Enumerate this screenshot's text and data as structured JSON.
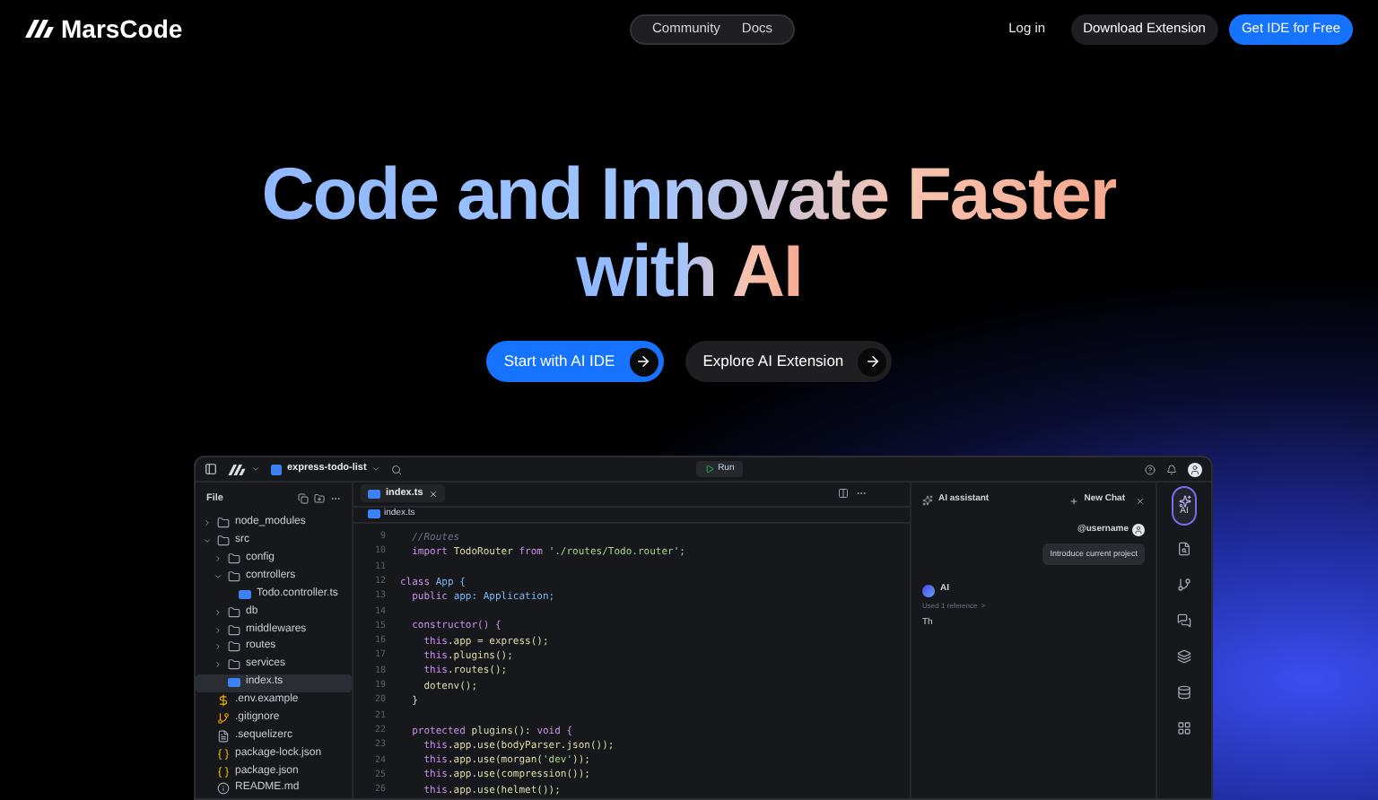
{
  "nav": {
    "brand": "MarsCode",
    "links": [
      {
        "label": "Community"
      },
      {
        "label": "Docs"
      }
    ],
    "login": "Log in",
    "download": "Download Extension",
    "cta": "Get IDE for Free"
  },
  "hero": {
    "title_lines": [
      "Code and Innovate Faster",
      "with AI"
    ],
    "buttons": [
      {
        "label": "Start with AI IDE",
        "kind": "primary"
      },
      {
        "label": "Explore AI Extension",
        "kind": "secondary"
      }
    ]
  },
  "ide": {
    "project": "express-todo-list",
    "run": "Run",
    "explorer": {
      "title": "File",
      "items": [
        {
          "name": "node_modules",
          "kind": "folder",
          "expanded": false,
          "selected": false
        },
        {
          "name": "src",
          "kind": "folder",
          "expanded": true,
          "selected": false,
          "children": [
            {
              "name": "config",
              "kind": "folder",
              "expanded": false,
              "selected": false
            },
            {
              "name": "controllers",
              "kind": "folder",
              "expanded": true,
              "selected": false,
              "children": [
                {
                  "name": "Todo.controller.ts",
                  "kind": "ts",
                  "selected": false
                }
              ]
            },
            {
              "name": "db",
              "kind": "folder",
              "expanded": false,
              "selected": false
            },
            {
              "name": "middlewares",
              "kind": "folder",
              "expanded": false,
              "selected": false
            },
            {
              "name": "routes",
              "kind": "folder",
              "expanded": false,
              "selected": false
            },
            {
              "name": "services",
              "kind": "folder",
              "expanded": false,
              "selected": false
            },
            {
              "name": "index.ts",
              "kind": "ts",
              "selected": true
            }
          ]
        },
        {
          "name": ".env.example",
          "kind": "env",
          "selected": false
        },
        {
          "name": ".gitignore",
          "kind": "git",
          "selected": false
        },
        {
          "name": ".sequelizerc",
          "kind": "file",
          "selected": false
        },
        {
          "name": "package-lock.json",
          "kind": "json",
          "selected": false
        },
        {
          "name": "package.json",
          "kind": "json",
          "selected": false
        },
        {
          "name": "README.md",
          "kind": "info",
          "selected": false
        }
      ]
    },
    "editor": {
      "tab": "index.ts",
      "breadcrumb": "index.ts",
      "lines": [
        {
          "n": "9",
          "segs": [
            {
              "text": "  //Routes",
              "kind": "comment"
            }
          ]
        },
        {
          "n": "10",
          "segs": [
            {
              "text": "  import ",
              "kind": "keyword"
            },
            {
              "text": "TodoRouter ",
              "kind": "name"
            },
            {
              "text": "from ",
              "kind": "keyword"
            },
            {
              "text": "'./routes/Todo.router';",
              "kind": "string"
            }
          ]
        },
        {
          "n": "11"
        },
        {
          "n": "12",
          "segs": [
            {
              "text": "class ",
              "kind": "keyword"
            },
            {
              "text": "App {",
              "kind": "type"
            }
          ]
        },
        {
          "n": "13",
          "segs": [
            {
              "text": "  public ",
              "kind": "keyword"
            },
            {
              "text": "app: Application;",
              "kind": "type"
            }
          ]
        },
        {
          "n": "14"
        },
        {
          "n": "15",
          "segs": [
            {
              "text": "  constructor() {",
              "kind": "keyword"
            }
          ]
        },
        {
          "n": "16",
          "segs": [
            {
              "text": "    this",
              "kind": "keyword"
            },
            {
              "text": ".app = express();",
              "kind": "name"
            }
          ]
        },
        {
          "n": "17",
          "segs": [
            {
              "text": "    this",
              "kind": "keyword"
            },
            {
              "text": ".plugins();",
              "kind": "name"
            }
          ]
        },
        {
          "n": "18",
          "segs": [
            {
              "text": "    this",
              "kind": "keyword"
            },
            {
              "text": ".routes();",
              "kind": "name"
            }
          ]
        },
        {
          "n": "19",
          "segs": [
            {
              "text": "    dotenv();",
              "kind": "name"
            }
          ]
        },
        {
          "n": "20",
          "segs": [
            {
              "text": "  }",
              "kind": "plain"
            }
          ]
        },
        {
          "n": "21"
        },
        {
          "n": "22",
          "segs": [
            {
              "text": "  protected ",
              "kind": "keyword"
            },
            {
              "text": "plugins(): ",
              "kind": "name"
            },
            {
              "text": "void {",
              "kind": "keyword"
            }
          ]
        },
        {
          "n": "23",
          "segs": [
            {
              "text": "    this",
              "kind": "keyword"
            },
            {
              "text": ".app.use(bodyParser.json());",
              "kind": "name"
            }
          ]
        },
        {
          "n": "24",
          "segs": [
            {
              "text": "    this",
              "kind": "keyword"
            },
            {
              "text": ".app.use(morgan(",
              "kind": "name"
            },
            {
              "text": "'dev'",
              "kind": "string"
            },
            {
              "text": "));",
              "kind": "name"
            }
          ]
        },
        {
          "n": "25",
          "segs": [
            {
              "text": "    this",
              "kind": "keyword"
            },
            {
              "text": ".app.use(compression());",
              "kind": "name"
            }
          ]
        },
        {
          "n": "26",
          "segs": [
            {
              "text": "    this",
              "kind": "keyword"
            },
            {
              "text": ".app.use(helmet());",
              "kind": "name"
            }
          ]
        }
      ]
    },
    "assistant": {
      "title": "AI assistant",
      "new_chat": "New Chat",
      "user": "@username",
      "user_message": "Introduce current project",
      "ai_name": "AI",
      "reference": "Used 1 reference  >",
      "reply": "Th"
    },
    "activity": [
      {
        "kind": "ai",
        "label": "AI",
        "selected": true
      },
      {
        "kind": "file",
        "selected": false
      },
      {
        "kind": "branch",
        "selected": false
      },
      {
        "kind": "chat",
        "selected": false
      },
      {
        "kind": "layers",
        "selected": false
      },
      {
        "kind": "database",
        "selected": false
      },
      {
        "kind": "grid",
        "selected": false
      }
    ]
  }
}
